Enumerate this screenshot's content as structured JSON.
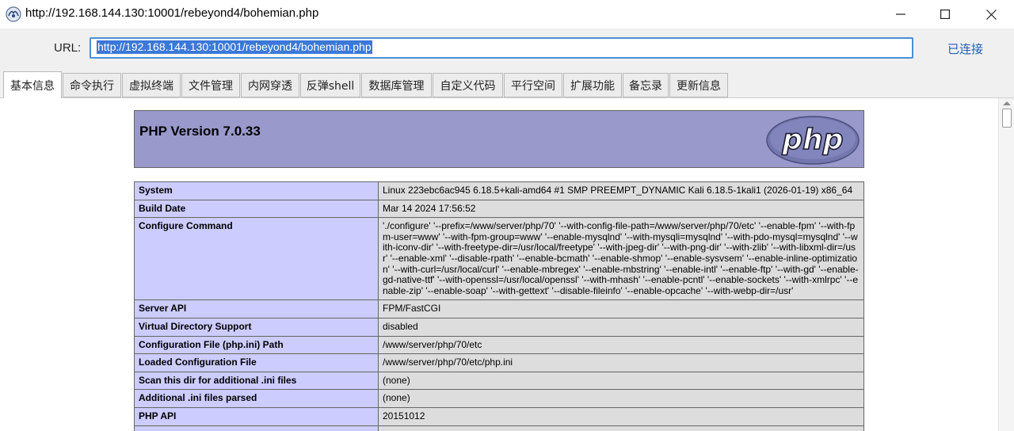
{
  "window": {
    "title": "http://192.168.144.130:10001/rebeyond4/bohemian.php",
    "controls": {
      "minimize": "minimize",
      "maximize": "maximize",
      "close": "close"
    }
  },
  "url_bar": {
    "label": "URL:",
    "value": "http://192.168.144.130:10001/rebeyond4/bohemian.php",
    "status": "已连接"
  },
  "tabs": [
    {
      "label": "基本信息",
      "active": true
    },
    {
      "label": "命令执行"
    },
    {
      "label": "虚拟终端"
    },
    {
      "label": "文件管理"
    },
    {
      "label": "内网穿透"
    },
    {
      "label": "反弹shell"
    },
    {
      "label": "数据库管理"
    },
    {
      "label": "自定义代码"
    },
    {
      "label": "平行空间"
    },
    {
      "label": "扩展功能"
    },
    {
      "label": "备忘录"
    },
    {
      "label": "更新信息"
    }
  ],
  "phpinfo": {
    "version_title": "PHP Version 7.0.33",
    "logo_text": "php",
    "rows": [
      {
        "key": "System",
        "value": "Linux 223ebc6ac945 6.18.5+kali-amd64 #1 SMP PREEMPT_DYNAMIC Kali 6.18.5-1kali1 (2026-01-19) x86_64"
      },
      {
        "key": "Build Date",
        "value": "Mar 14 2024 17:56:52"
      },
      {
        "key": "Configure Command",
        "value": "'./configure' '--prefix=/www/server/php/70' '--with-config-file-path=/www/server/php/70/etc' '--enable-fpm' '--with-fpm-user=www' '--with-fpm-group=www' '--enable-mysqlnd' '--with-mysqli=mysqlnd' '--with-pdo-mysql=mysqlnd' '--with-iconv-dir' '--with-freetype-dir=/usr/local/freetype' '--with-jpeg-dir' '--with-png-dir' '--with-zlib' '--with-libxml-dir=/usr' '--enable-xml' '--disable-rpath' '--enable-bcmath' '--enable-shmop' '--enable-sysvsem' '--enable-inline-optimization' '--with-curl=/usr/local/curl' '--enable-mbregex' '--enable-mbstring' '--enable-intl' '--enable-ftp' '--with-gd' '--enable-gd-native-ttf' '--with-openssl=/usr/local/openssl' '--with-mhash' '--enable-pcntl' '--enable-sockets' '--with-xmlrpc' '--enable-zip' '--enable-soap' '--with-gettext' '--disable-fileinfo' '--enable-opcache' '--with-webp-dir=/usr'"
      },
      {
        "key": "Server API",
        "value": "FPM/FastCGI"
      },
      {
        "key": "Virtual Directory Support",
        "value": "disabled"
      },
      {
        "key": "Configuration File (php.ini) Path",
        "value": "/www/server/php/70/etc"
      },
      {
        "key": "Loaded Configuration File",
        "value": "/www/server/php/70/etc/php.ini"
      },
      {
        "key": "Scan this dir for additional .ini files",
        "value": "(none)"
      },
      {
        "key": "Additional .ini files parsed",
        "value": "(none)"
      },
      {
        "key": "PHP API",
        "value": "20151012"
      },
      {
        "key": "",
        "value": ""
      }
    ]
  },
  "colors": {
    "php_header": "#9999cc",
    "key_cell": "#ccccff",
    "value_cell": "#dddddd",
    "url_highlight": "#3b78d8",
    "status_text": "#1f5fb8"
  }
}
